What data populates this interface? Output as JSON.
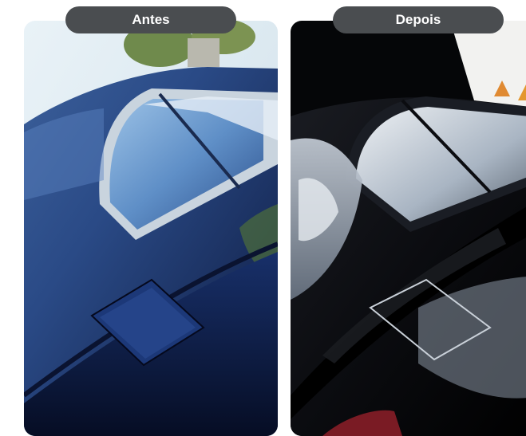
{
  "comparison": {
    "before_label": "Antes",
    "after_label": "Depois"
  },
  "colors": {
    "label_background": "#4a4d50",
    "label_text": "#ffffff",
    "page_background": "#ffffff"
  }
}
